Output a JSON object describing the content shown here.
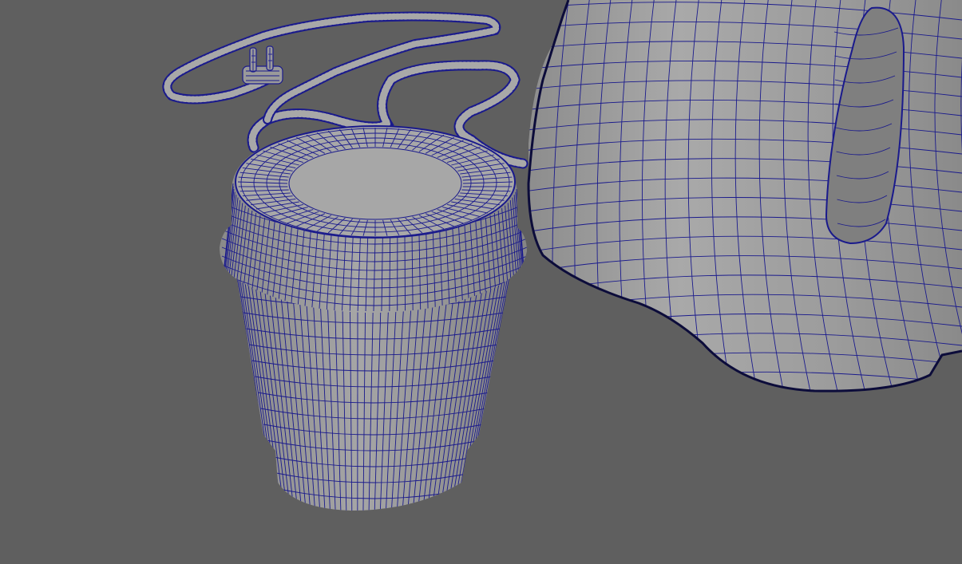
{
  "viewport": {
    "background": "#5f5f5f",
    "wire_color": "#1a1a8c",
    "surface_color": "#9a9a9a",
    "surface_light": "#a8a8a8",
    "surface_dark": "#7f7f7f"
  },
  "objects": [
    {
      "name": "cylindrical-base",
      "type": "polygon mesh"
    },
    {
      "name": "kettle-body",
      "type": "polygon mesh"
    },
    {
      "name": "power-cord",
      "type": "polygon mesh"
    },
    {
      "name": "power-plug",
      "type": "polygon mesh"
    }
  ]
}
